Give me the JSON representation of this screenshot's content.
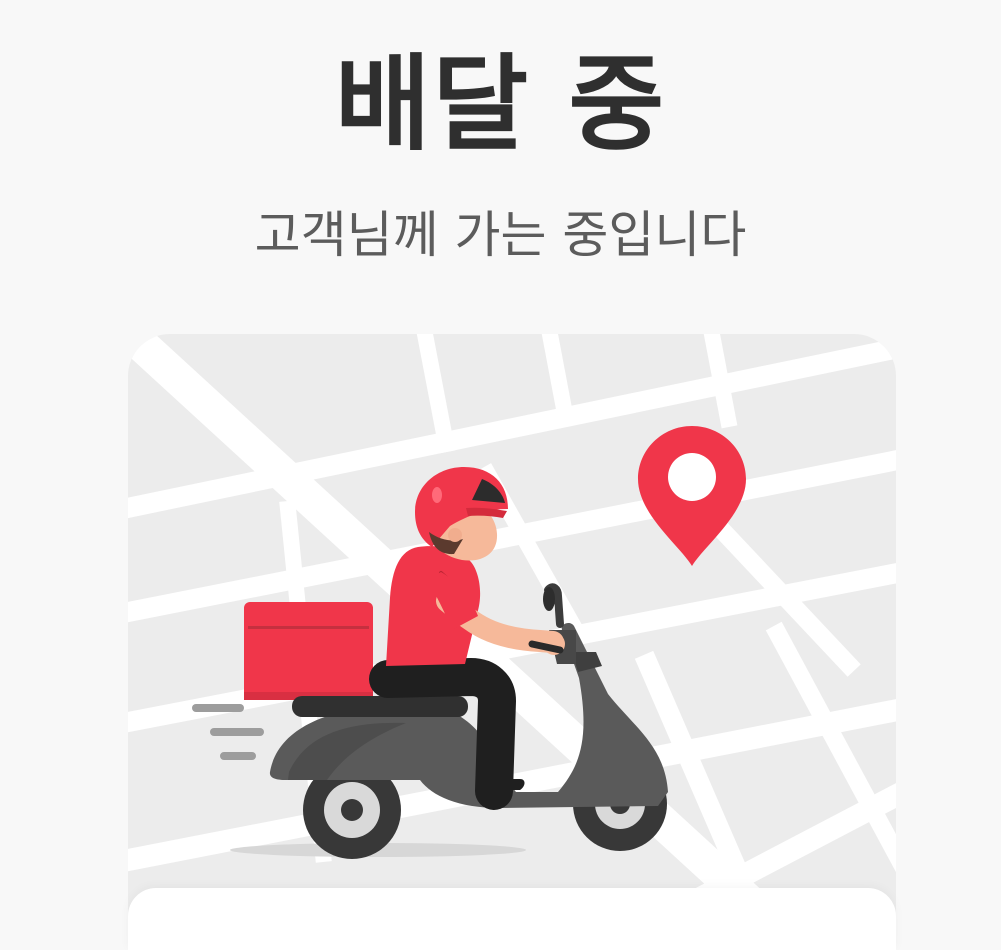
{
  "header": {
    "title": "배달 중",
    "subtitle": "고객님께 가는 중입니다"
  },
  "map": {
    "destination_icon": "location-pin-icon",
    "rider_icon": "delivery-scooter-icon"
  },
  "colors": {
    "accent": "#f0364a",
    "map_background": "#ececec",
    "road": "#ffffff",
    "title": "#2f2f2f",
    "subtitle": "#5c5c5c"
  }
}
